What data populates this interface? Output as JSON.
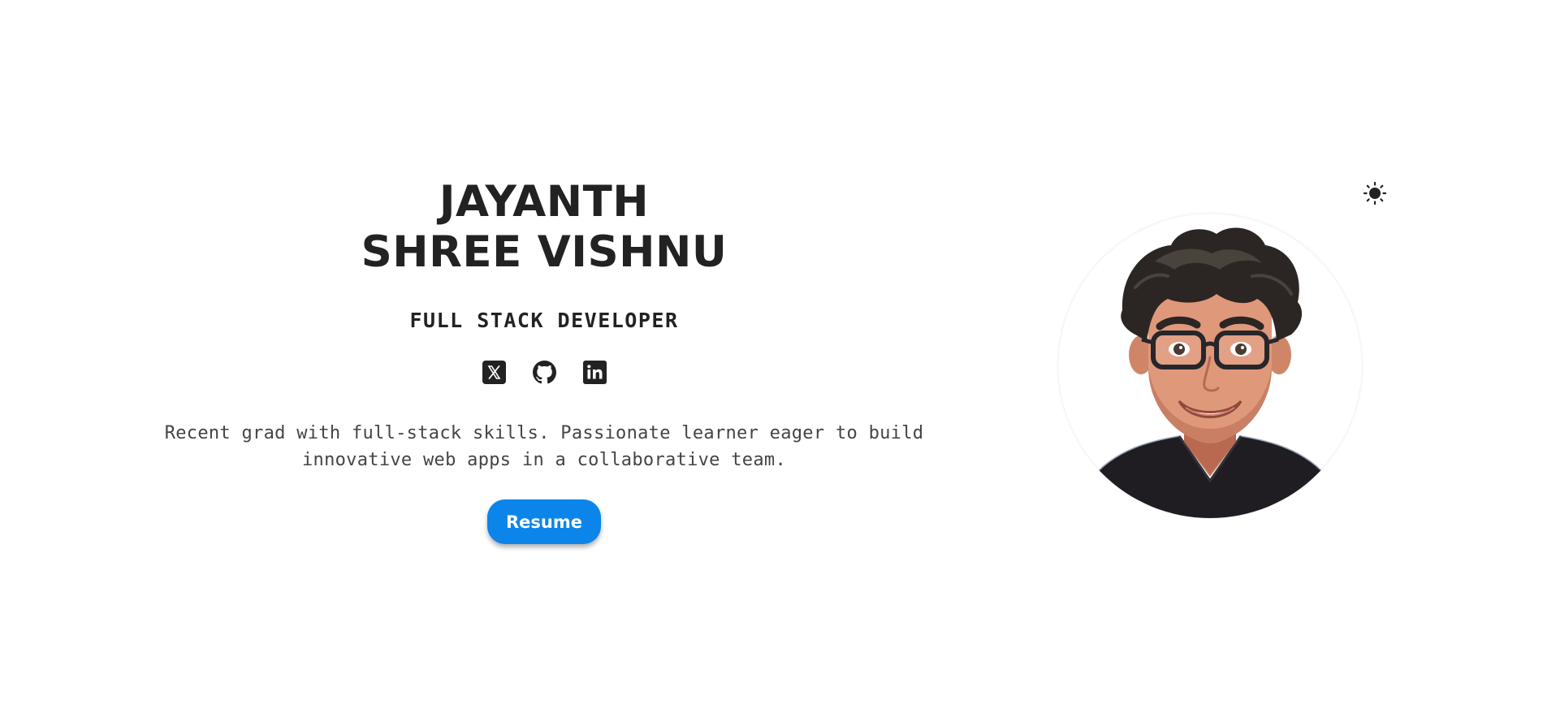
{
  "hero": {
    "name_line1": "JAYANTH",
    "name_line2": "SHREE VISHNU",
    "role": "FULL STACK DEVELOPER",
    "bio_line1": "Recent grad with full-stack skills. Passionate learner eager to build",
    "bio_line2": "innovative web apps in a collaborative team.",
    "resume_label": "Resume"
  },
  "socials": [
    {
      "name": "x-icon"
    },
    {
      "name": "github-icon"
    },
    {
      "name": "linkedin-icon"
    }
  ],
  "theme_toggle": {
    "icon": "sun-icon"
  },
  "colors": {
    "text": "#222222",
    "bio_text": "#444444",
    "accent": "#0b85ea",
    "background": "#ffffff"
  }
}
